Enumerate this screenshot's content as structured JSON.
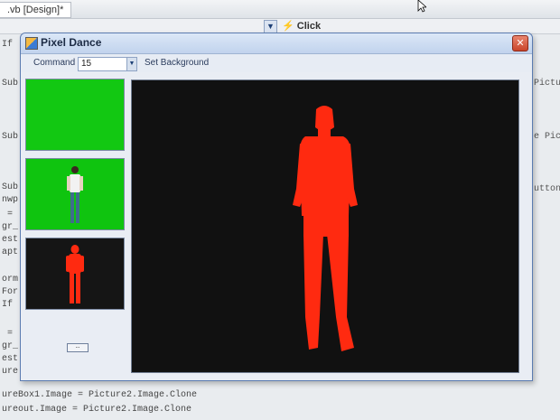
{
  "ide": {
    "tab_title": ".vb [Design]*",
    "event_dropdown": "Click",
    "left_code_lines": [
      "If",
      "Sub",
      "Sub",
      "Sub",
      "nwp",
      "=",
      "gr_",
      "est",
      "apt",
      "orm",
      "For",
      "If",
      "=",
      "gr_",
      "est",
      "ure"
    ],
    "right_code_lines": [
      "Pictu",
      "e Pic",
      "utton"
    ],
    "bottom_code_lines": [
      "ureBox1.Image = Picture2.Image.Clone",
      "ureout.Image = Picture2.Image.Clone"
    ]
  },
  "window": {
    "title": "Pixel Dance",
    "close_glyph": "✕",
    "toolbar": {
      "command_label": "Command",
      "command_value": "15",
      "set_background_label": "Set Background"
    },
    "small_button_label": "..."
  },
  "colors": {
    "green_screen": "#12c812",
    "silhouette": "#ff2a10",
    "view_background": "#111111"
  }
}
